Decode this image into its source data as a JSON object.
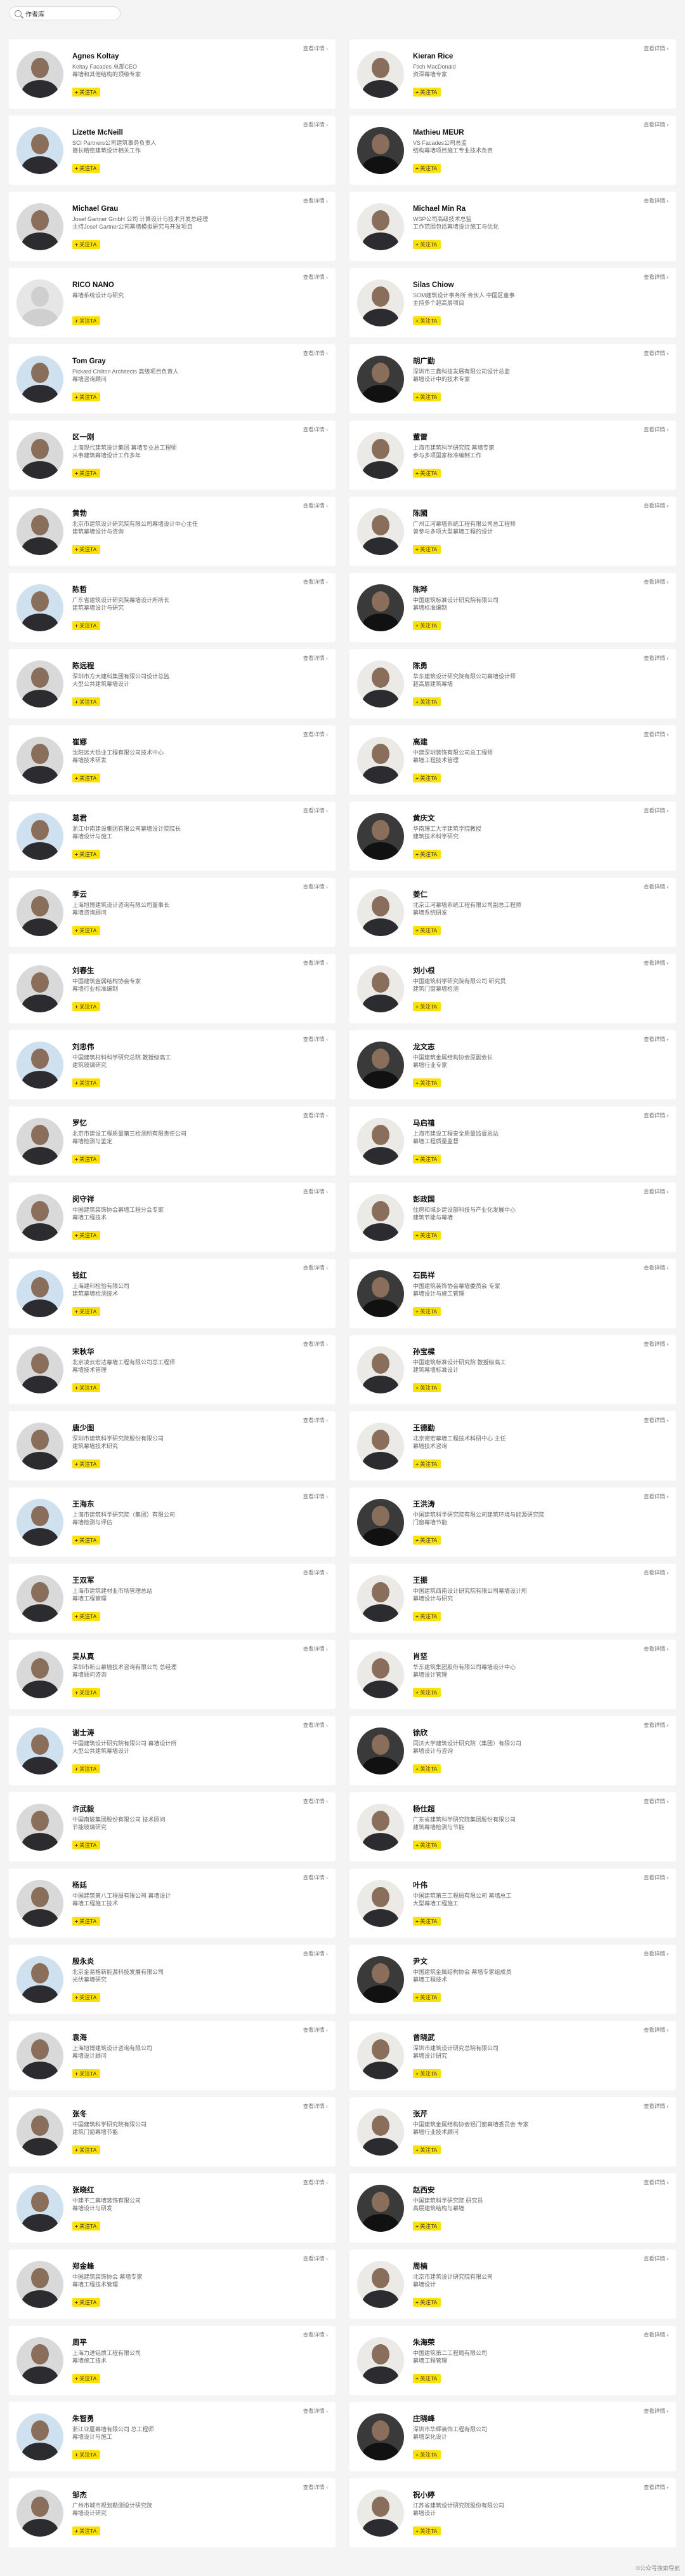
{
  "search": {
    "value": "作者库"
  },
  "detail_label": "查看详情 ›",
  "follow_label": "关注TA",
  "watermark": "©公众号搜索导航",
  "people": [
    {
      "name": "Agnes Koltay",
      "desc": "Koltay Facades 总部CEO\n幕墙和其他结构的顶级专家"
    },
    {
      "name": "Kieran Rice",
      "desc": "Ftich MacDonald\n资深幕墙专家"
    },
    {
      "name": "Lizette McNeill",
      "desc": "SCI Partners公司建筑事务负责人\n擅长精密建筑设计相关工作"
    },
    {
      "name": "Mathieu MEUR",
      "desc": "VS Facades公司总监\n结构幕墙项目施工专业技术负责"
    },
    {
      "name": "Michael Grau",
      "desc": "Josef Gartner GmbH 公司 计算设计与技术开发总经理\n主持Josef Gartner公司幕墙模拟研究与开发项目"
    },
    {
      "name": "Michael Min Ra",
      "desc": "WSP公司高级技术总监\n工作范围包括幕墙设计施工与优化"
    },
    {
      "name": "RICO NANO",
      "desc": "幕墙系统设计与研究"
    },
    {
      "name": "Silas Chiow",
      "desc": "SOM建筑设计事务所 合伙人 中国区董事\n主持多个超高层项目"
    },
    {
      "name": "Tom Gray",
      "desc": "Pickard Chilton Architects 高级项目负责人\n幕墙咨询顾问"
    },
    {
      "name": "胡广勤",
      "desc": "深圳市三鑫科技发展有限公司设计总监\n幕墙设计中的技术专家"
    },
    {
      "name": "区一刚",
      "desc": "上海现代建筑设计集团 幕墙专业总工程师\n从事建筑幕墙设计工作多年"
    },
    {
      "name": "董雷",
      "desc": "上海市建筑科学研究院 幕墙专家\n参与多项国家标准编制工作"
    },
    {
      "name": "黄勃",
      "desc": "北京市建筑设计研究院有限公司幕墙设计中心主任\n建筑幕墙设计与咨询"
    },
    {
      "name": "陈國",
      "desc": "广州江河幕墙系统工程有限公司总工程师\n曾参与多项大型幕墙工程的设计"
    },
    {
      "name": "陈哲",
      "desc": "广东省建筑设计研究院幕墙设计所所长\n建筑幕墙设计与研究"
    },
    {
      "name": "陈晔",
      "desc": "中国建筑标准设计研究院有限公司\n幕墙标准编制"
    },
    {
      "name": "陈远程",
      "desc": "深圳市方大建科集团有限公司设计总监\n大型公共建筑幕墙设计"
    },
    {
      "name": "陈勇",
      "desc": "华东建筑设计研究院有限公司幕墙设计师\n超高层建筑幕墙"
    },
    {
      "name": "崔娜",
      "desc": "沈阳远大铝业工程有限公司技术中心\n幕墙技术研发"
    },
    {
      "name": "高建",
      "desc": "中建深圳装饰有限公司总工程师\n幕墙工程技术管理"
    },
    {
      "name": "葛君",
      "desc": "浙江中南建设集团有限公司幕墙设计院院长\n幕墙设计与施工"
    },
    {
      "name": "黄庆文",
      "desc": "华南理工大学建筑学院教授\n建筑技术科学研究"
    },
    {
      "name": "季云",
      "desc": "上海旭博建筑设计咨询有限公司董事长\n幕墙咨询顾问"
    },
    {
      "name": "姜仁",
      "desc": "北京江河幕墙系统工程有限公司副总工程师\n幕墙系统研发"
    },
    {
      "name": "刘春生",
      "desc": "中国建筑金属结构协会专家\n幕墙行业标准编制"
    },
    {
      "name": "刘小根",
      "desc": "中国建筑科学研究院有限公司 研究员\n建筑门窗幕墙检测"
    },
    {
      "name": "刘忠伟",
      "desc": "中国建筑材料科学研究总院 教授级高工\n建筑玻璃研究"
    },
    {
      "name": "龙文志",
      "desc": "中国建筑金属结构协会原副会长\n幕墙行业专家"
    },
    {
      "name": "罗忆",
      "desc": "北京市建设工程质量第三检测所有限责任公司\n幕墙检测与鉴定"
    },
    {
      "name": "马启禧",
      "desc": "上海市建设工程安全质量监督总站\n幕墙工程质量监督"
    },
    {
      "name": "闵守祥",
      "desc": "中国建筑装饰协会幕墙工程分会专家\n幕墙工程技术"
    },
    {
      "name": "彭政国",
      "desc": "住房和城乡建设部科技与产业化发展中心\n建筑节能与幕墙"
    },
    {
      "name": "钱红",
      "desc": "上海建科检验有限公司\n建筑幕墙检测技术"
    },
    {
      "name": "石民祥",
      "desc": "中国建筑装饰协会幕墙委员会 专家\n幕墙设计与施工管理"
    },
    {
      "name": "宋秋华",
      "desc": "北京凌云宏达幕墙工程有限公司总工程师\n幕墙技术管理"
    },
    {
      "name": "孙宝樑",
      "desc": "中国建筑标准设计研究院 教授级高工\n建筑幕墙标准设计"
    },
    {
      "name": "唐少图",
      "desc": "深圳市建筑科学研究院股份有限公司\n建筑幕墙技术研究"
    },
    {
      "name": "王德勤",
      "desc": "北京德宏幕墙工程技术科研中心 主任\n幕墙技术咨询"
    },
    {
      "name": "王海东",
      "desc": "上海市建筑科学研究院（集团）有限公司\n幕墙检测与评估"
    },
    {
      "name": "王洪涛",
      "desc": "中国建筑科学研究院有限公司建筑环境与能源研究院\n门窗幕墙节能"
    },
    {
      "name": "王双军",
      "desc": "上海市建筑建材业市场管理总站\n幕墙工程管理"
    },
    {
      "name": "王振",
      "desc": "中国建筑西南设计研究院有限公司幕墙设计所\n幕墙设计与研究"
    },
    {
      "name": "吴从真",
      "desc": "深圳市新山幕墙技术咨询有限公司 总经理\n幕墙顾问咨询"
    },
    {
      "name": "肖坚",
      "desc": "华东建筑集团股份有限公司幕墙设计中心\n幕墙设计管理"
    },
    {
      "name": "谢士涛",
      "desc": "中国建筑设计研究院有限公司 幕墙设计所\n大型公共建筑幕墙设计"
    },
    {
      "name": "徐欣",
      "desc": "同济大学建筑设计研究院（集团）有限公司\n幕墙设计与咨询"
    },
    {
      "name": "许武毅",
      "desc": "中国南玻集团股份有限公司 技术顾问\n节能玻璃研究"
    },
    {
      "name": "杨仕超",
      "desc": "广东省建筑科学研究院集团股份有限公司\n建筑幕墙检测与节能"
    },
    {
      "name": "杨廷",
      "desc": "中国建筑第八工程局有限公司 幕墙设计\n幕墙工程施工技术"
    },
    {
      "name": "叶伟",
      "desc": "中国建筑第三工程局有限公司 幕墙总工\n大型幕墙工程施工"
    },
    {
      "name": "殷永炎",
      "desc": "北京金易格新能源科技发展有限公司\n光伏幕墙研究"
    },
    {
      "name": "尹文",
      "desc": "中国建筑金属结构协会 幕墙专家组成员\n幕墙工程技术"
    },
    {
      "name": "袁海",
      "desc": "上海旭博建筑设计咨询有限公司\n幕墙设计顾问"
    },
    {
      "name": "曾晓武",
      "desc": "深圳市建筑设计研究总院有限公司\n幕墙设计研究"
    },
    {
      "name": "张冬",
      "desc": "中国建筑科学研究院有限公司\n建筑门窗幕墙节能"
    },
    {
      "name": "张芹",
      "desc": "中国建筑金属结构协会铝门窗幕墙委员会 专家\n幕墙行业技术顾问"
    },
    {
      "name": "张晓红",
      "desc": "中建不二幕墙装饰有限公司\n幕墙设计与研发"
    },
    {
      "name": "赵西安",
      "desc": "中国建筑科学研究院 研究员\n高层建筑结构与幕墙"
    },
    {
      "name": "郑金峰",
      "desc": "中国建筑装饰协会 幕墙专家\n幕墙工程技术管理"
    },
    {
      "name": "周楠",
      "desc": "北京市建筑设计研究院有限公司\n幕墙设计"
    },
    {
      "name": "周平",
      "desc": "上海力进铝质工程有限公司\n幕墙施工技术"
    },
    {
      "name": "朱海荣",
      "desc": "中国建筑第二工程局有限公司\n幕墙工程管理"
    },
    {
      "name": "朱智勇",
      "desc": "浙江亚厦幕墙有限公司 总工程师\n幕墙设计与施工"
    },
    {
      "name": "庄晓峰",
      "desc": "深圳市华辉装饰工程有限公司\n幕墙深化设计"
    },
    {
      "name": "邹杰",
      "desc": "广州市城市规划勘测设计研究院\n幕墙设计研究"
    },
    {
      "name": "祝小婷",
      "desc": "江苏省建筑设计研究院股份有限公司\n幕墙设计"
    }
  ]
}
